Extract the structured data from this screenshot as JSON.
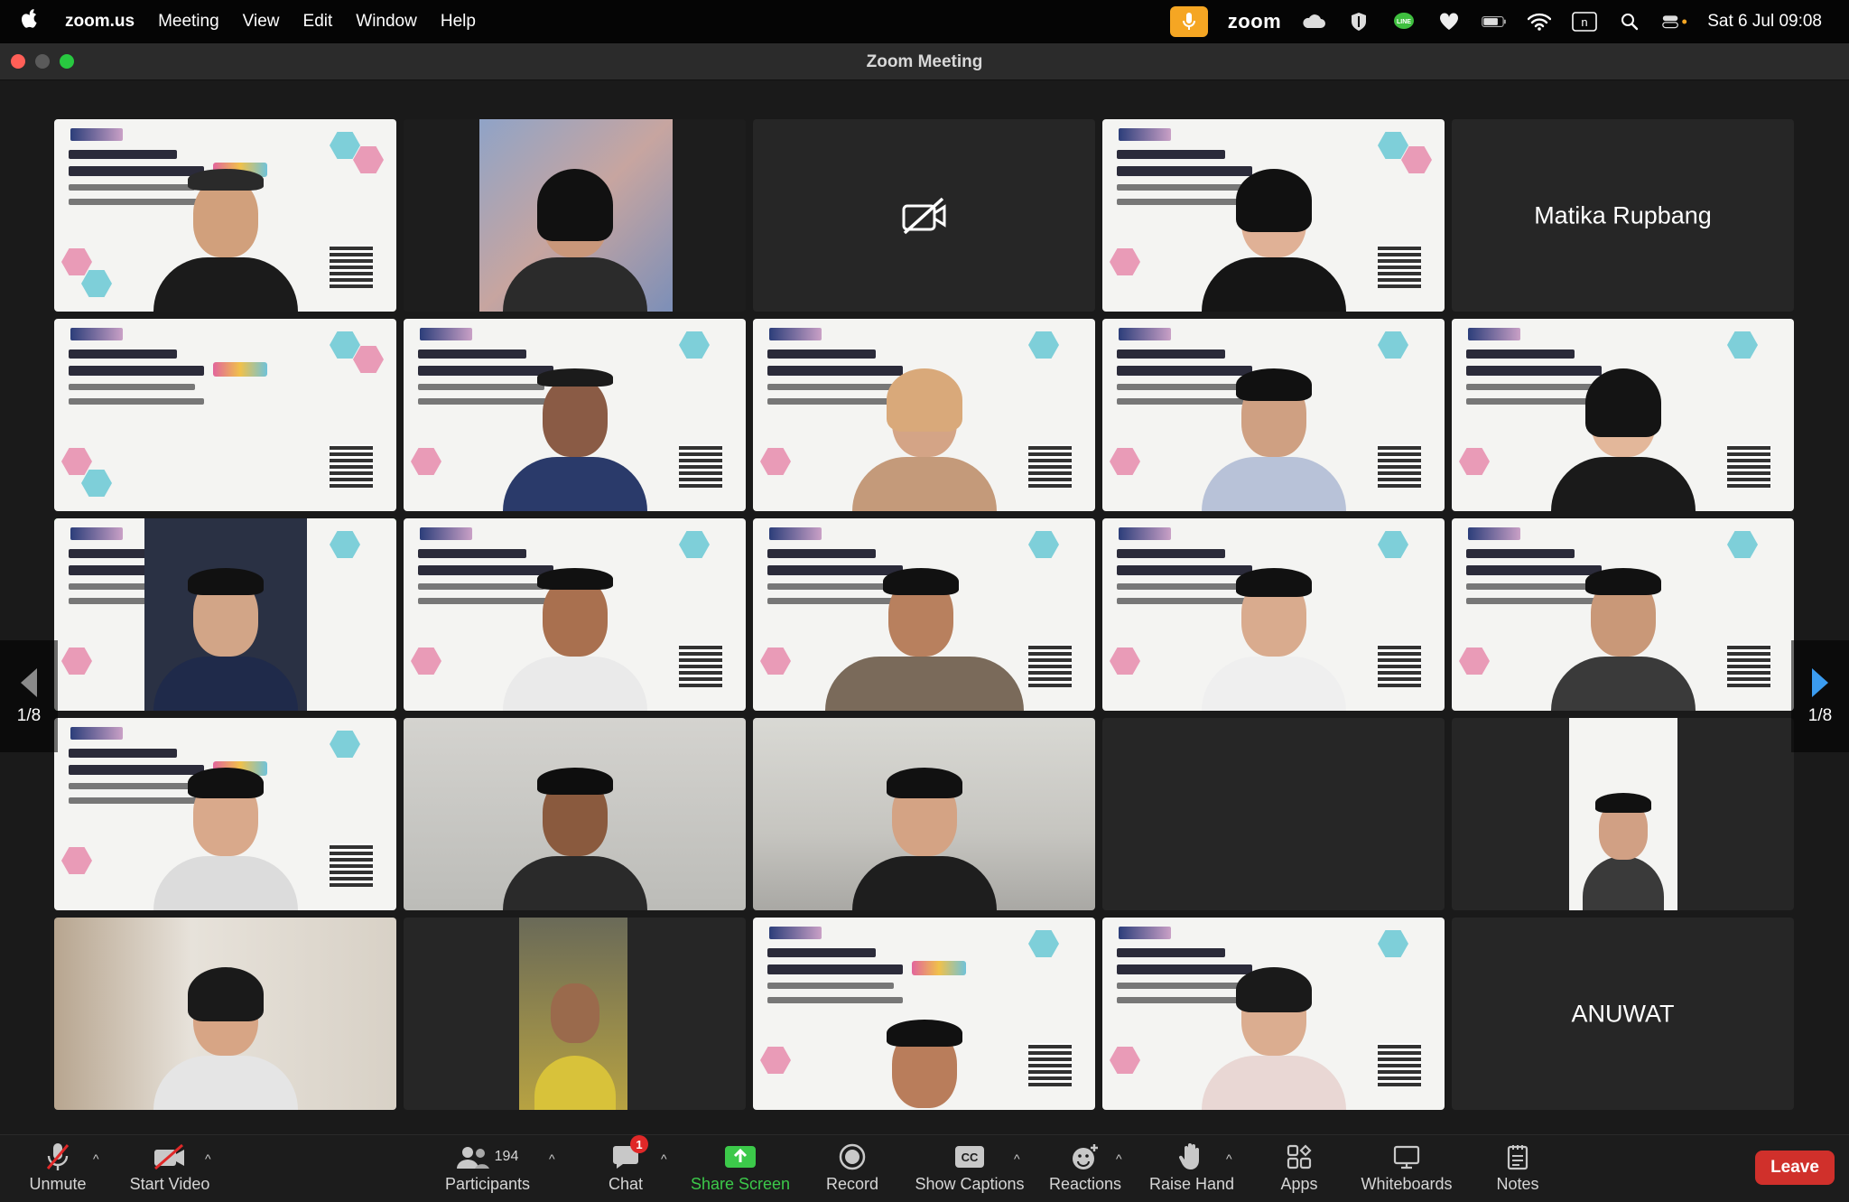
{
  "menubar": {
    "app": "zoom.us",
    "items": [
      "Meeting",
      "View",
      "Edit",
      "Window",
      "Help"
    ],
    "zoom_label": "zoom",
    "clock": "Sat 6 Jul  09:08"
  },
  "window": {
    "title": "Zoom Meeting"
  },
  "gallery": {
    "participants": [
      {
        "row": 1,
        "col": 1,
        "kind": "slide"
      },
      {
        "row": 1,
        "col": 2,
        "kind": "video"
      },
      {
        "row": 1,
        "col": 3,
        "kind": "camera-off"
      },
      {
        "row": 1,
        "col": 4,
        "kind": "slide"
      },
      {
        "row": 1,
        "col": 5,
        "kind": "name",
        "name": "Matika Rupbang"
      },
      {
        "row": 2,
        "col": 1,
        "kind": "slide-empty"
      },
      {
        "row": 2,
        "col": 2,
        "kind": "slide"
      },
      {
        "row": 2,
        "col": 3,
        "kind": "slide"
      },
      {
        "row": 2,
        "col": 4,
        "kind": "slide"
      },
      {
        "row": 2,
        "col": 5,
        "kind": "slide"
      },
      {
        "row": 3,
        "col": 1,
        "kind": "slide",
        "active_speaker": true
      },
      {
        "row": 3,
        "col": 2,
        "kind": "slide"
      },
      {
        "row": 3,
        "col": 3,
        "kind": "slide"
      },
      {
        "row": 3,
        "col": 4,
        "kind": "slide"
      },
      {
        "row": 3,
        "col": 5,
        "kind": "slide"
      },
      {
        "row": 4,
        "col": 1,
        "kind": "slide"
      },
      {
        "row": 4,
        "col": 2,
        "kind": "video"
      },
      {
        "row": 4,
        "col": 3,
        "kind": "video"
      },
      {
        "row": 4,
        "col": 4,
        "kind": "blank"
      },
      {
        "row": 4,
        "col": 5,
        "kind": "narrow-video"
      },
      {
        "row": 5,
        "col": 1,
        "kind": "video"
      },
      {
        "row": 5,
        "col": 2,
        "kind": "narrow-video"
      },
      {
        "row": 5,
        "col": 3,
        "kind": "slide"
      },
      {
        "row": 5,
        "col": 4,
        "kind": "slide"
      },
      {
        "row": 5,
        "col": 5,
        "kind": "name",
        "name": "ANUWAT"
      }
    ],
    "pager_left": "1/8",
    "pager_right": "1/8"
  },
  "toolbar": {
    "unmute": "Unmute",
    "start_video": "Start Video",
    "participants": "Participants",
    "participants_count": "194",
    "chat": "Chat",
    "chat_badge": "1",
    "share_screen": "Share Screen",
    "record": "Record",
    "show_captions": "Show Captions",
    "reactions": "Reactions",
    "raise_hand": "Raise Hand",
    "apps": "Apps",
    "whiteboards": "Whiteboards",
    "notes": "Notes",
    "leave": "Leave"
  },
  "colors": {
    "active_speaker": "#3cc94a",
    "share_green": "#3cc94a",
    "leave_red": "#d0302b",
    "mic_indicator": "#f5a623",
    "pager_arrow": "#3b9cf0"
  }
}
